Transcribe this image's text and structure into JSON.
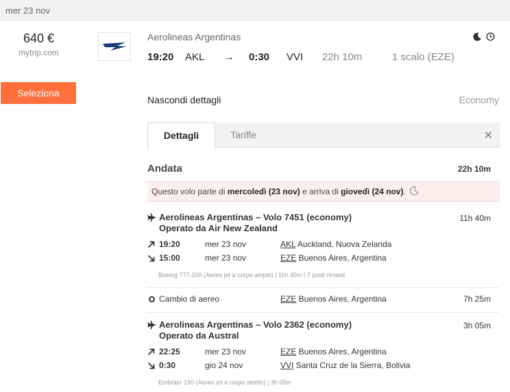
{
  "date_bar": {
    "label": "mer 23 nov"
  },
  "offer": {
    "price": "640 €",
    "site": "mytrip.com",
    "select_label": "Seleziona"
  },
  "flight": {
    "airline": "Aerolineas Argentinas",
    "dep_time": "19:20",
    "dep_code": "AKL",
    "arrow": "→",
    "arr_time": "0:30",
    "arr_code": "VVI",
    "duration": "22h 10m",
    "stops": "1 scalo (EZE)",
    "icons": [
      "moon-icon",
      "clock-icon"
    ]
  },
  "details_toggle": "Nascondi dettagli",
  "cabin": "Economy",
  "tabs": [
    {
      "label": "Dettagli",
      "active": true
    },
    {
      "label": "Tariffe",
      "active": false
    }
  ],
  "close_glyph": "✕",
  "outbound": {
    "title": "Andata",
    "duration": "22h 10m",
    "notice": {
      "p1": "Questo volo parte di ",
      "dep_day": "mercoledì (23 nov)",
      "p2": " e arriva di ",
      "arr_day": "giovedì (24 nov)",
      "p3": "."
    },
    "segments": [
      {
        "title": "Aerolineas Argentinas – Volo 7451 (economy)",
        "operated": "Operato da Air New Zealand",
        "duration": "11h 40m",
        "dep": {
          "time": "19:20",
          "date": "mer 23 nov",
          "code": "AKL",
          "place": " Auckland, Nuova Zelanda"
        },
        "arr": {
          "time": "15:00",
          "date": "mer 23 nov",
          "code": "EZE",
          "place": " Buenos Aires, Argentina"
        },
        "aircraft": "Boeing 777-200 (Aereo jet a corpo ampio)  |  11h 40m  |  7 posti rimasti"
      },
      {
        "title": "Aerolineas Argentinas – Volo 2362 (economy)",
        "operated": "Operato da Austral",
        "duration": "3h 05m",
        "dep": {
          "time": "22:25",
          "date": "mer 23 nov",
          "code": "EZE",
          "place": " Buenos Aires, Argentina"
        },
        "arr": {
          "time": "0:30",
          "date": "gio 24 nov",
          "code": "VVI",
          "place": " Santa Cruz de la Sierra, Bolivia"
        },
        "aircraft": "Embraer 190 (Aereo jet a corpo stretto)  |  3h 05m"
      }
    ],
    "layover": {
      "label": "Cambio di aereo",
      "code": "EZE",
      "place": " Buenos Aires, Argentina",
      "duration": "7h 25m"
    }
  },
  "colors": {
    "accent": "#ff6f3c",
    "notice_bg": "#fdeeee",
    "logo_blue": "#1d3a78"
  }
}
